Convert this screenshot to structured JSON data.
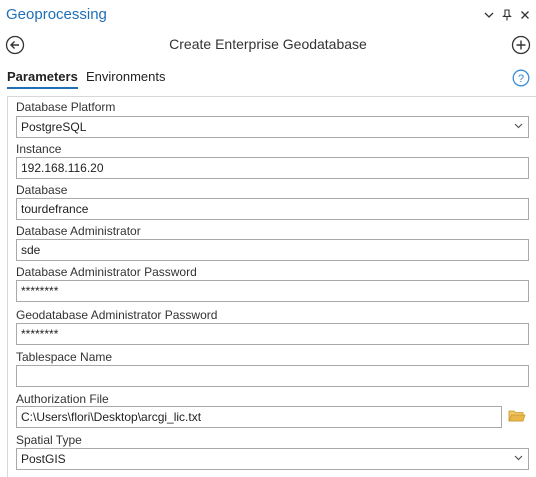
{
  "pane": {
    "title": "Geoprocessing",
    "controls": {
      "menu": "▾",
      "pin": "📌",
      "close": "✕"
    }
  },
  "tool": {
    "title": "Create Enterprise Geodatabase"
  },
  "tabs": [
    {
      "label": "Parameters",
      "active": true
    },
    {
      "label": "Environments",
      "active": false
    }
  ],
  "parameters": {
    "database_platform": {
      "label": "Database Platform",
      "value": "PostgreSQL"
    },
    "instance": {
      "label": "Instance",
      "value": "192.168.116.20"
    },
    "database": {
      "label": "Database",
      "value": "tourdefrance"
    },
    "db_admin": {
      "label": "Database Administrator",
      "value": "sde"
    },
    "db_admin_password": {
      "label": "Database Administrator Password",
      "value": "********"
    },
    "gdb_admin_password": {
      "label": "Geodatabase Administrator Password",
      "value": "********"
    },
    "tablespace": {
      "label": "Tablespace Name",
      "value": ""
    },
    "authorization_file": {
      "label": "Authorization File",
      "value": "C:\\Users\\flori\\Desktop\\arcgi_lic.txt"
    },
    "spatial_type": {
      "label": "Spatial Type",
      "value": "PostGIS"
    }
  },
  "colors": {
    "accent": "#1f6fb5",
    "help": "#3a8fd8",
    "folder": "#e8b64a"
  }
}
